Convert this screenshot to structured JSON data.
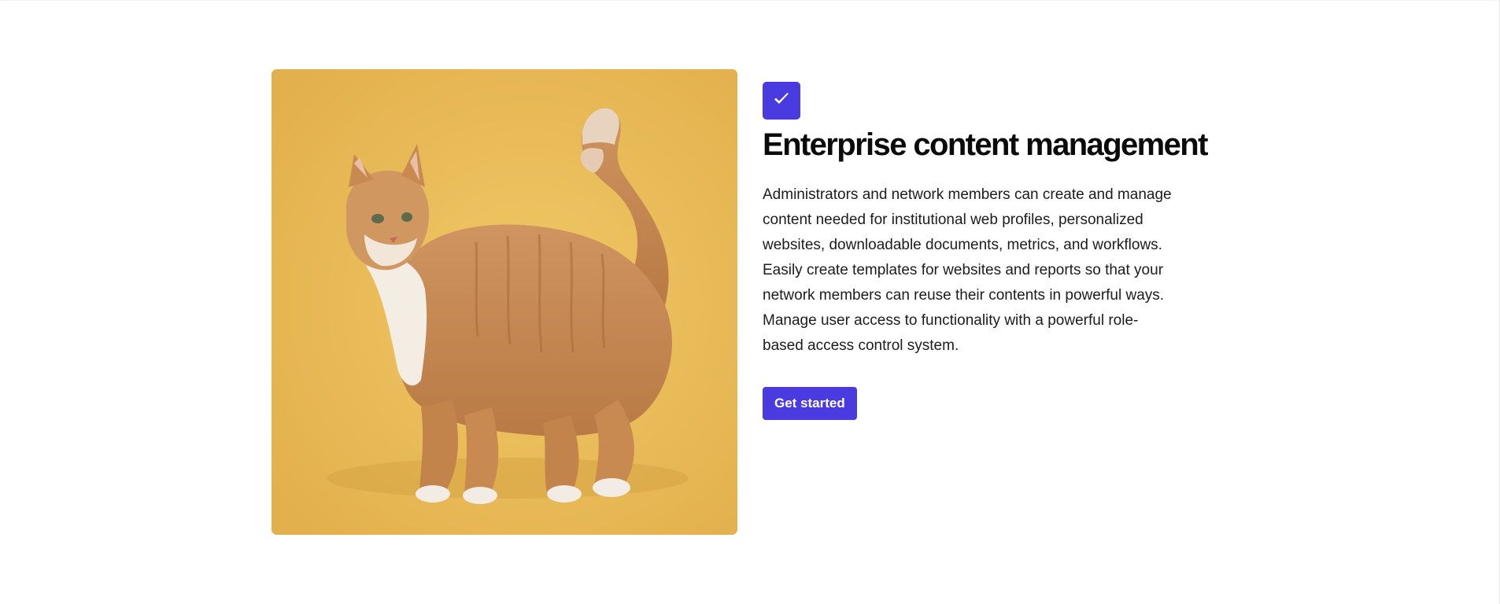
{
  "colors": {
    "accent": "#4a3be0",
    "image_background": "#e9bd5a",
    "cat_fur": "#c98a52",
    "cat_chest": "#f4ede4"
  },
  "feature": {
    "icon": "checkmark-icon",
    "title": "Enterprise content management",
    "paragraphs": [
      "Administrators and network members can create and manage content needed for institutional web profiles, personalized websites, downloadable documents, metrics, and workflows.",
      "Easily create templates for websites and reports so that your network members can reuse their contents in powerful ways. Manage user access to functionality with a powerful role-based access control system."
    ],
    "cta_label": "Get started"
  }
}
